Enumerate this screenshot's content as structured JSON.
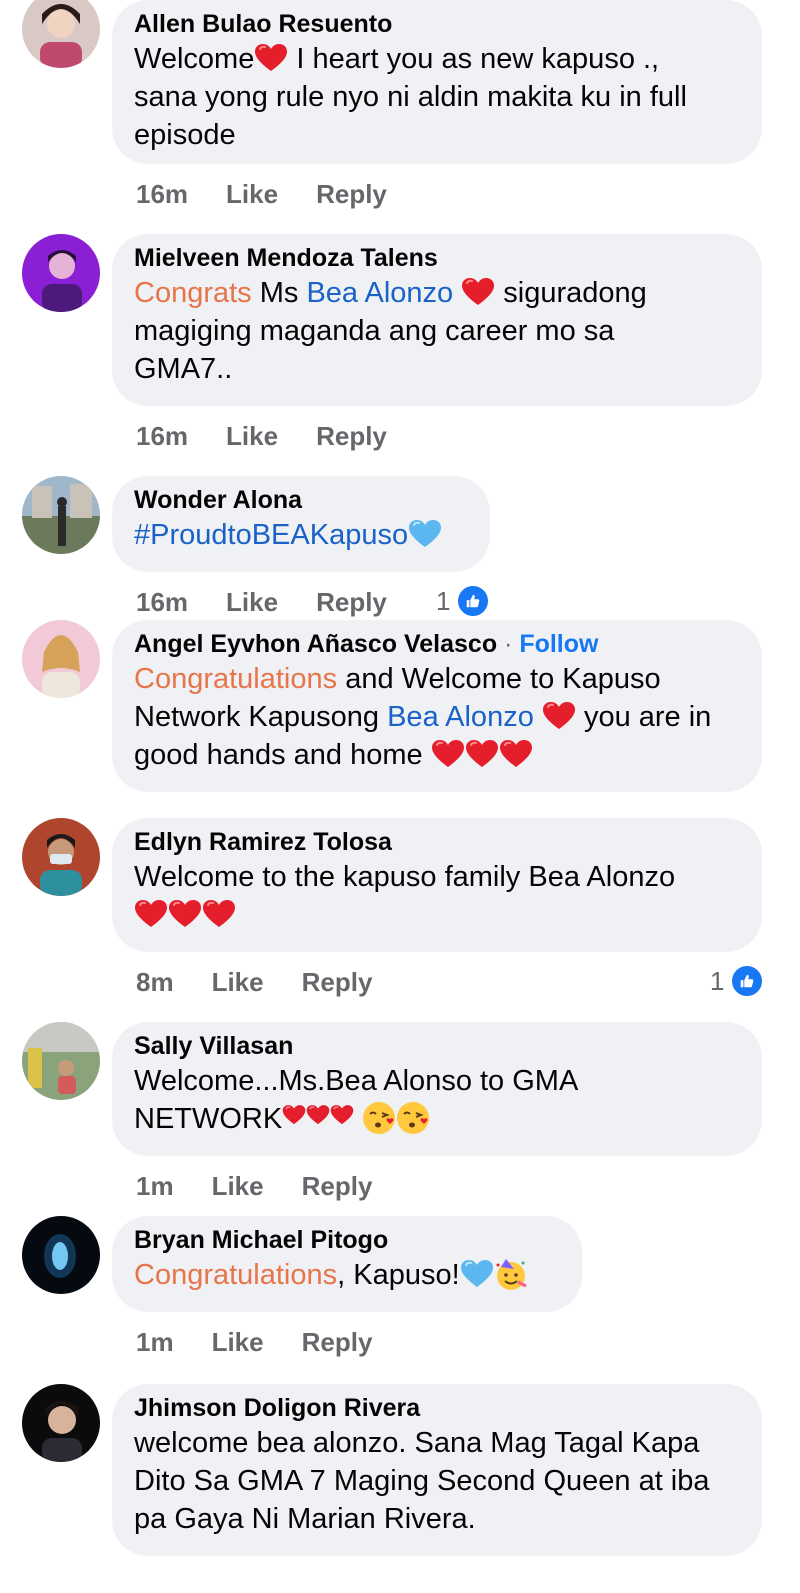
{
  "comments": [
    {
      "author": "Allen Bulao Resuento",
      "line1_a": "Welcome",
      "line1_b": " I heart you as new kapuso  .,",
      "line2": "sana yong rule nyo ni aldin  makita ku in full",
      "line3": "episode",
      "time": "16m",
      "like": "Like",
      "reply": "Reply"
    },
    {
      "author": "Mielveen Mendoza Talens",
      "congrats": "Congrats",
      "ms": " Ms ",
      "mention": "Bea Alonzo",
      "line1_b": " siguradong",
      "line2": "magiging maganda ang career mo sa",
      "line3": "GMA7..",
      "time": "16m",
      "like": "Like",
      "reply": "Reply"
    },
    {
      "author": "Wonder Alona",
      "hashtag": "#ProudtoBEAKapuso",
      "time": "16m",
      "like": "Like",
      "reply": "Reply",
      "reactions": "1"
    },
    {
      "author": "Angel Eyvhon Añasco Velasco",
      "sep": " · ",
      "follow": "Follow",
      "congrats": "Congratulations",
      "line1_b": " and Welcome to Kapuso",
      "line2_a": "Network Kapusong ",
      "mention": "Bea Alonzo",
      "line2_b": " you are in",
      "line3": "good hands and home"
    },
    {
      "author": "Edlyn Ramirez Tolosa",
      "line1": "Welcome to the kapuso family Bea Alonzo",
      "time": "8m",
      "like": "Like",
      "reply": "Reply",
      "reactions": "1"
    },
    {
      "author": "Sally Villasan",
      "line1": "Welcome...Ms.Bea Alonso  to GMA",
      "line2": "NETWORK",
      "time": "1m",
      "like": "Like",
      "reply": "Reply"
    },
    {
      "author": "Bryan Michael Pitogo",
      "congrats": "Congratulations",
      "rest": ", Kapuso!",
      "time": "1m",
      "like": "Like",
      "reply": "Reply"
    },
    {
      "author": "Jhimson Doligon Rivera",
      "line1": "welcome bea alonzo. Sana Mag Tagal Kapa",
      "line2": "Dito Sa GMA 7 Maging Second Queen at iba",
      "line3": "pa Gaya Ni Marian Rivera."
    }
  ],
  "colors": {
    "bubble": "#eff1f4",
    "accent_orange": "#e8754a",
    "mention_blue": "#1a62c8",
    "like_blue": "#1877f2",
    "meta_gray": "#65676b"
  },
  "icons": [
    "red-heart-icon",
    "blue-heart-icon",
    "sparkling-heart-icon",
    "kissing-face-icon",
    "party-face-icon",
    "thumbs-up-icon"
  ]
}
